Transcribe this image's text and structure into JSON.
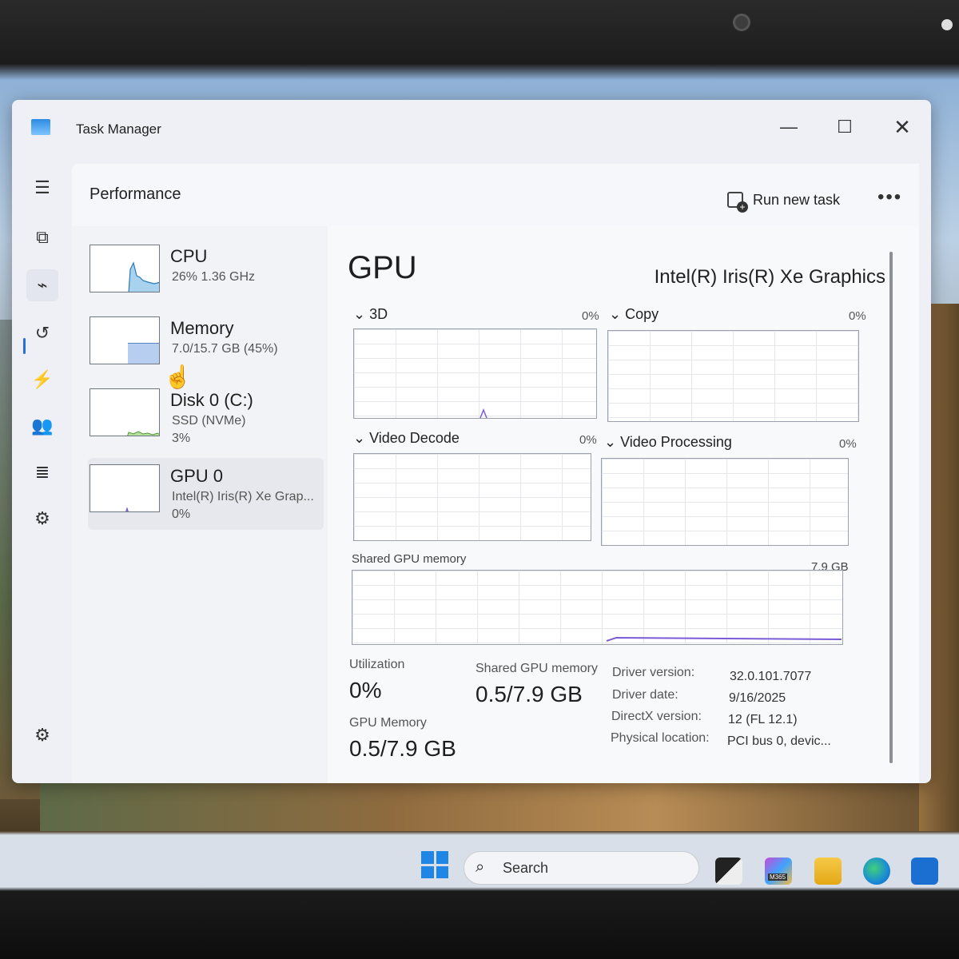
{
  "window": {
    "title": "Task Manager",
    "minimize": "—",
    "maximize": "☐",
    "close": "✕"
  },
  "nav": {
    "menu": "☰",
    "processes": "⧉",
    "performance": "⌁",
    "app_history": "↺",
    "startup_apps": "⚡",
    "users": "👥",
    "details": "≣",
    "services": "⚙",
    "settings": "⚙"
  },
  "header": {
    "page_title": "Performance",
    "run_new_task": "Run new task",
    "more": "•••"
  },
  "devices": [
    {
      "name": "CPU",
      "sub": "26%  1.36 GHz",
      "sub2": ""
    },
    {
      "name": "Memory",
      "sub": "7.0/15.7 GB (45%)",
      "sub2": ""
    },
    {
      "name": "Disk 0 (C:)",
      "sub": "SSD (NVMe)",
      "sub2": "3%"
    },
    {
      "name": "GPU 0",
      "sub": "Intel(R) Iris(R) Xe Grap...",
      "sub2": "0%"
    }
  ],
  "detail": {
    "title": "GPU",
    "model": "Intel(R) Iris(R) Xe Graphics",
    "engines": [
      {
        "label": "3D",
        "pct": "0%"
      },
      {
        "label": "Copy",
        "pct": "0%"
      },
      {
        "label": "Video Decode",
        "pct": "0%"
      },
      {
        "label": "Video Processing",
        "pct": "0%"
      }
    ],
    "shared_mem_graph_label": "Shared GPU memory",
    "shared_mem_graph_max": "7.9 GB",
    "utilization_label": "Utilization",
    "utilization_value": "0%",
    "shared_mem_label": "Shared GPU memory",
    "shared_mem_value": "0.5/7.9 GB",
    "gpu_mem_label": "GPU Memory",
    "gpu_mem_value": "0.5/7.9 GB",
    "info": [
      {
        "key": "Driver version:",
        "value": "32.0.101.7077"
      },
      {
        "key": "Driver date:",
        "value": "9/16/2025"
      },
      {
        "key": "DirectX version:",
        "value": "12 (FL 12.1)"
      },
      {
        "key": "Physical location:",
        "value": "PCI bus 0, devic..."
      }
    ]
  },
  "taskbar": {
    "search_placeholder": "Search",
    "search_icon": "search-icon",
    "m365_label": "M365"
  }
}
